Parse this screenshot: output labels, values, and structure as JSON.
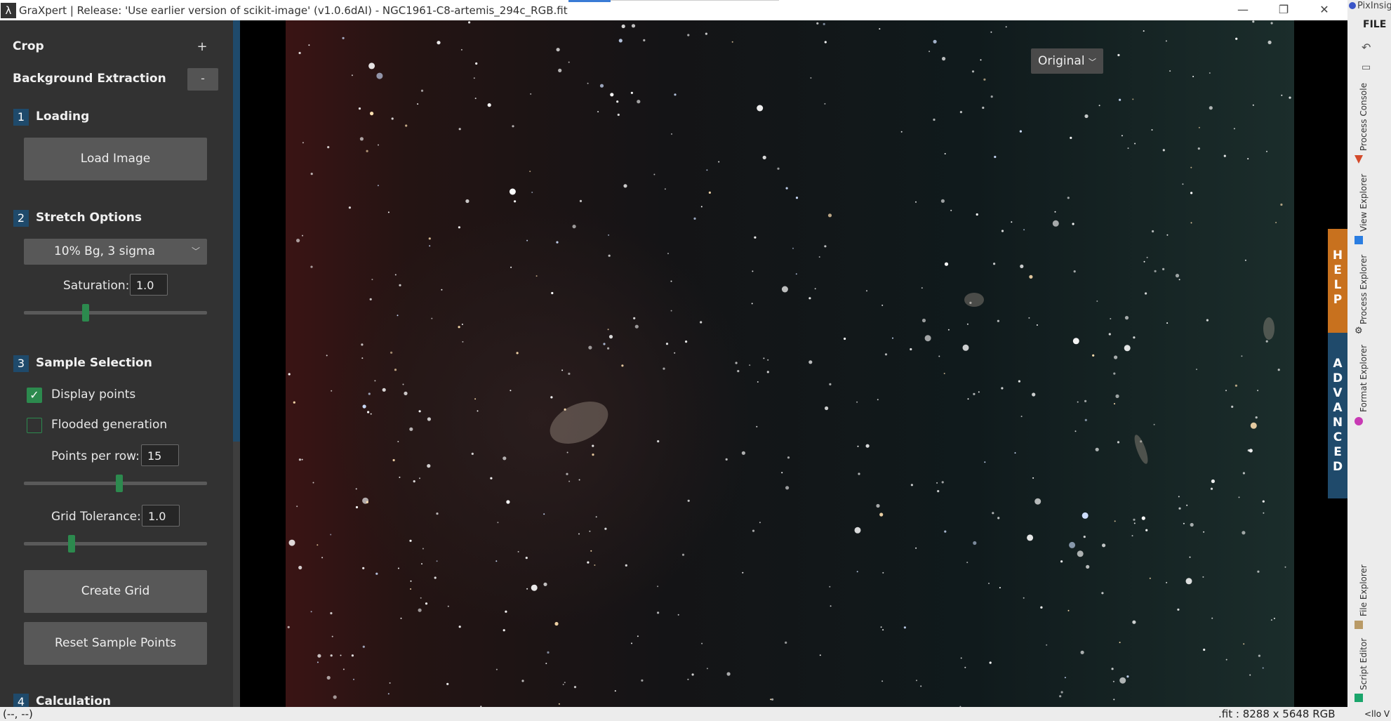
{
  "window": {
    "title": "GraXpert | Release: 'Use earlier version of scikit-image' (v1.0.6dAI) - NGC1961-C8-artemis_294c_RGB.fit",
    "minimize": "—",
    "restore": "❐",
    "close": "✕"
  },
  "sidebar": {
    "crop_label": "Crop",
    "crop_toggle": "+",
    "bg_label": "Background Extraction",
    "bg_toggle": "-",
    "steps": [
      {
        "num": "1",
        "title": "Loading"
      },
      {
        "num": "2",
        "title": "Stretch Options"
      },
      {
        "num": "3",
        "title": "Sample Selection"
      },
      {
        "num": "4",
        "title": "Calculation"
      }
    ],
    "load_image": "Load Image",
    "stretch_value": "10% Bg, 3 sigma",
    "saturation_label": "Saturation:",
    "saturation_value": "1.0",
    "saturation_level": 0.33,
    "display_points": "Display points",
    "display_points_checked": true,
    "flooded": "Flooded generation",
    "flooded_checked": false,
    "points_label": "Points per row:",
    "points_value": "15",
    "points_level": 0.52,
    "grid_label": "Grid Tolerance:",
    "grid_value": "1.0",
    "grid_level": 0.25,
    "create_grid": "Create Grid",
    "reset_points": "Reset Sample Points"
  },
  "view": {
    "mode": "Original",
    "help_letters": [
      "H",
      "E",
      "L",
      "P"
    ],
    "advanced_letters": [
      "A",
      "D",
      "V",
      "A",
      "N",
      "C",
      "E",
      "D"
    ]
  },
  "pixinsight": {
    "app": "PixInsig",
    "file_menu": "FILE",
    "panels": [
      "Process Console",
      "View Explorer",
      "Process Explorer",
      "Format Explorer",
      "File Explorer",
      "Script Editor"
    ],
    "bottom_text": "<llo V"
  },
  "status": {
    "coords": "(--, --)",
    "info": ".fit : 8288 x 5648 RGB"
  }
}
